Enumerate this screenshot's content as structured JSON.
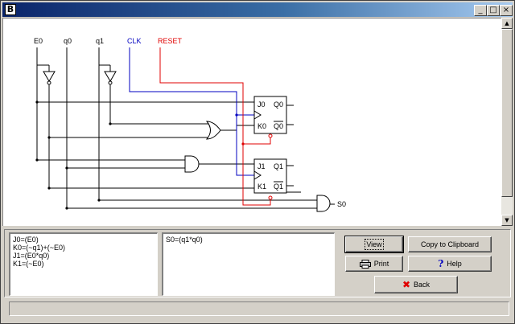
{
  "window": {
    "title_icon": "B"
  },
  "titlebar": {
    "min_glyph": "_",
    "max_glyph": "□",
    "close_glyph": "×"
  },
  "circuit": {
    "inputs": {
      "e0": "E0",
      "q0": "q0",
      "q1": "q1",
      "clk": "CLK",
      "reset": "RESET"
    },
    "ff1": {
      "j": "J0",
      "k": "K0",
      "q": "Q0",
      "qbar": "Q0"
    },
    "ff2": {
      "j": "J1",
      "k": "K1",
      "q": "Q1",
      "qbar": "Q1"
    },
    "output": "S0",
    "colors": {
      "wire": "#000000",
      "clk": "#0000c0",
      "reset": "#e00000"
    }
  },
  "equations": {
    "flipflop_lines": [
      "J0=(E0)",
      "K0=(~q1)+(~E0)",
      "J1=(E0*q0)",
      "K1=(~E0)"
    ],
    "output_lines": [
      "S0=(q1*q0)"
    ]
  },
  "buttons": {
    "view": "View",
    "copy": "Copy to Clipboard",
    "print": "Print",
    "help": "Help",
    "back": "Back"
  },
  "scrollbar": {
    "up": "▲",
    "down": "▼"
  }
}
